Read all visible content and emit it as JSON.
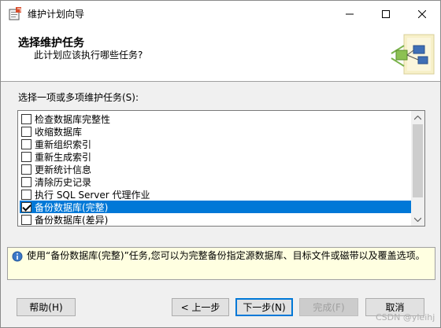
{
  "window": {
    "title": "维护计划向导"
  },
  "header": {
    "title": "选择维护任务",
    "subtitle": "此计划应该执行哪些任务?"
  },
  "task_list": {
    "label": "选择一项或多项维护任务(S):",
    "items": [
      {
        "label": "检查数据库完整性",
        "checked": false,
        "selected": false
      },
      {
        "label": "收缩数据库",
        "checked": false,
        "selected": false
      },
      {
        "label": "重新组织索引",
        "checked": false,
        "selected": false
      },
      {
        "label": "重新生成索引",
        "checked": false,
        "selected": false
      },
      {
        "label": "更新统计信息",
        "checked": false,
        "selected": false
      },
      {
        "label": "清除历史记录",
        "checked": false,
        "selected": false
      },
      {
        "label": "执行 SQL Server 代理作业",
        "checked": false,
        "selected": false
      },
      {
        "label": "备份数据库(完整)",
        "checked": true,
        "selected": true
      },
      {
        "label": "备份数据库(差异)",
        "checked": false,
        "selected": false
      }
    ]
  },
  "description": {
    "text": "使用“备份数据库(完整)”任务,您可以为完整备份指定源数据库、目标文件或磁带以及覆盖选项。"
  },
  "buttons": {
    "help": "帮助(H)",
    "back": "< 上一步",
    "next": "下一步(N)",
    "finish": "完成(F)",
    "cancel": "取消"
  },
  "watermark": "CSDN @yleihj",
  "colors": {
    "selection": "#0078d7",
    "info_background": "#ffffe1",
    "primary_button_border": "#0078d7"
  }
}
